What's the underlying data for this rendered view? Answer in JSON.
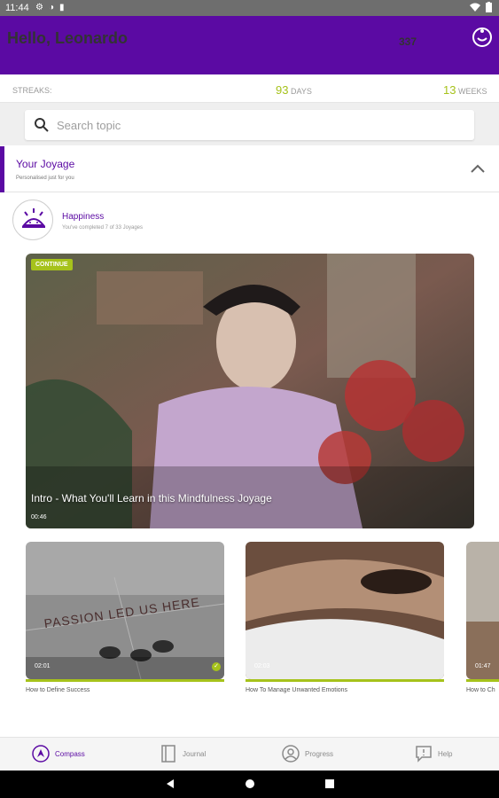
{
  "statusbar": {
    "time": "11:44"
  },
  "header": {
    "greeting": "Hello, Leonardo",
    "points": "337"
  },
  "streaks": {
    "label": "STREAKS:",
    "days_count": "93",
    "days_unit": "DAYS",
    "weeks_count": "13",
    "weeks_unit": "WEEKS"
  },
  "search": {
    "placeholder": "Search topic"
  },
  "joyage": {
    "title": "Your Joyage",
    "subtitle": "Personalised just for you"
  },
  "topic": {
    "name": "Happiness",
    "progress": "You've completed 7 of 33 Joyages"
  },
  "hero": {
    "badge": "CONTINUE",
    "title": "Intro - What You'll Learn in this Mindfulness Joyage",
    "duration": "00:46"
  },
  "cards": [
    {
      "title": "How to Define Success",
      "duration": "02:01",
      "overlay_text": "PASSION LED US HERE",
      "completed": true
    },
    {
      "title": "How To Manage Unwanted Emotions",
      "duration": "02:03",
      "completed": false
    },
    {
      "title": "How to Ch",
      "duration": "01:47",
      "completed": false
    }
  ],
  "nav": {
    "compass": "Compass",
    "journal": "Journal",
    "progress": "Progress",
    "help": "Help"
  },
  "colors": {
    "brand": "#5b0aa3",
    "accent": "#a6c21b"
  }
}
